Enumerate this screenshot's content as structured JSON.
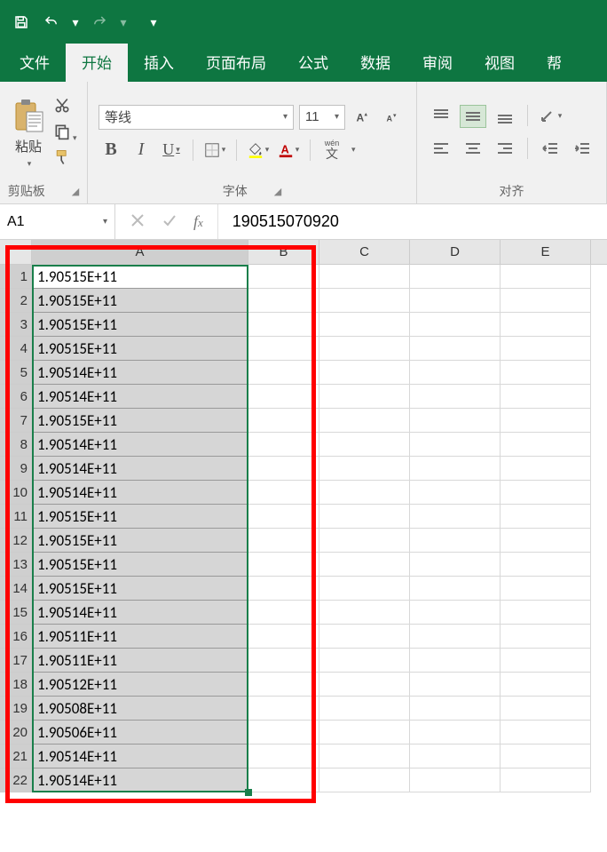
{
  "qat": {},
  "tabs": {
    "file": "文件",
    "home": "开始",
    "insert": "插入",
    "layout": "页面布局",
    "formulas": "公式",
    "data": "数据",
    "review": "审阅",
    "view": "视图",
    "help": "帮"
  },
  "ribbon": {
    "clipboard": {
      "paste": "粘贴",
      "group_label": "剪贴板"
    },
    "font": {
      "name": "等线",
      "size": "11",
      "bold": "B",
      "italic": "I",
      "underline": "U",
      "phonetic": "wén",
      "phonetic2": "文",
      "group_label": "字体"
    },
    "align": {
      "group_label": "对齐"
    }
  },
  "namebox": {
    "value": "A1"
  },
  "formula_bar": {
    "value": "190515070920"
  },
  "columns": [
    "A",
    "B",
    "C",
    "D",
    "E"
  ],
  "rows": [
    {
      "n": 1,
      "A": "1.90515E+11"
    },
    {
      "n": 2,
      "A": "1.90515E+11"
    },
    {
      "n": 3,
      "A": "1.90515E+11"
    },
    {
      "n": 4,
      "A": "1.90515E+11"
    },
    {
      "n": 5,
      "A": "1.90514E+11"
    },
    {
      "n": 6,
      "A": "1.90514E+11"
    },
    {
      "n": 7,
      "A": "1.90515E+11"
    },
    {
      "n": 8,
      "A": "1.90514E+11"
    },
    {
      "n": 9,
      "A": "1.90514E+11"
    },
    {
      "n": 10,
      "A": "1.90514E+11"
    },
    {
      "n": 11,
      "A": "1.90515E+11"
    },
    {
      "n": 12,
      "A": "1.90515E+11"
    },
    {
      "n": 13,
      "A": "1.90515E+11"
    },
    {
      "n": 14,
      "A": "1.90515E+11"
    },
    {
      "n": 15,
      "A": "1.90514E+11"
    },
    {
      "n": 16,
      "A": "1.90511E+11"
    },
    {
      "n": 17,
      "A": "1.90511E+11"
    },
    {
      "n": 18,
      "A": "1.90512E+11"
    },
    {
      "n": 19,
      "A": "1.90508E+11"
    },
    {
      "n": 20,
      "A": "1.90506E+11"
    },
    {
      "n": 21,
      "A": "1.90514E+11"
    },
    {
      "n": 22,
      "A": "1.90514E+11"
    }
  ],
  "selection": {
    "range": "A1:A22",
    "active": "A1"
  }
}
